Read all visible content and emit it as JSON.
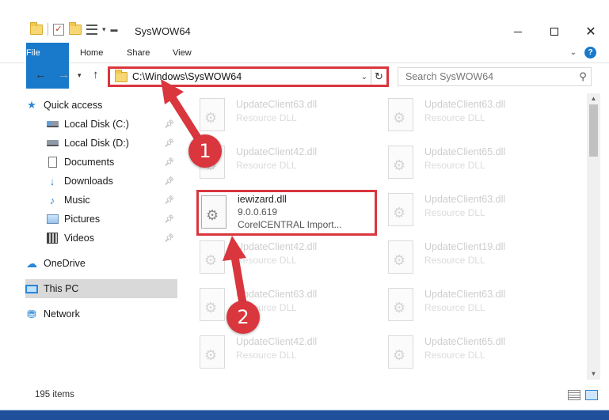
{
  "window": {
    "title": "SysWOW64",
    "minimize_label": "",
    "maximize_label": "",
    "close_label": "✕"
  },
  "ribbon": {
    "tabs": [
      "File",
      "Home",
      "Share",
      "View"
    ],
    "help": "?"
  },
  "address_bar": {
    "path": "C:\\Windows\\SysWOW64",
    "search_placeholder": "Search SysWOW64"
  },
  "sidebar": {
    "items": [
      {
        "label": "Quick access",
        "icon": "star-icon"
      },
      {
        "label": "Local Disk (C:)",
        "icon": "drive-icon",
        "pinned": true
      },
      {
        "label": "Local Disk (D:)",
        "icon": "drive-icon",
        "pinned": true
      },
      {
        "label": "Documents",
        "icon": "documents-icon",
        "pinned": true
      },
      {
        "label": "Downloads",
        "icon": "downloads-icon",
        "pinned": true
      },
      {
        "label": "Music",
        "icon": "music-icon",
        "pinned": true
      },
      {
        "label": "Pictures",
        "icon": "pictures-icon",
        "pinned": true
      },
      {
        "label": "Videos",
        "icon": "videos-icon",
        "pinned": true
      },
      {
        "label": "OneDrive",
        "icon": "onedrive-icon"
      },
      {
        "label": "This PC",
        "icon": "this-pc-icon",
        "selected": true
      },
      {
        "label": "Network",
        "icon": "network-icon"
      }
    ]
  },
  "files": {
    "left": [
      {
        "name": "UpdateClient63.dll",
        "desc": "Resource DLL"
      },
      {
        "name": "UpdateClient42.dll",
        "desc": "Resource DLL"
      },
      {
        "name": "iewizard.dll",
        "version": "9.0.0.619",
        "desc": "CorelCENTRAL Import..."
      },
      {
        "name": "UpdateClient42.dll",
        "desc": "Resource DLL"
      },
      {
        "name": "UpdateClient63.dll",
        "desc": "Resource DLL"
      },
      {
        "name": "UpdateClient42.dll",
        "desc": "Resource DLL"
      }
    ],
    "right": [
      {
        "name": "UpdateClient63.dll",
        "desc": "Resource DLL"
      },
      {
        "name": "UpdateClient65.dll",
        "desc": "Resource DLL"
      },
      {
        "name": "UpdateClient63.dll",
        "desc": "Resource DLL"
      },
      {
        "name": "UpdateClient19.dll",
        "desc": "Resource DLL"
      },
      {
        "name": "UpdateClient63.dll",
        "desc": "Resource DLL"
      },
      {
        "name": "UpdateClient65.dll",
        "desc": "Resource DLL"
      }
    ]
  },
  "status": {
    "item_count": "195 items"
  },
  "callouts": [
    "1",
    "2"
  ],
  "colors": {
    "accent": "#1979ca",
    "highlight": "#d9363e"
  }
}
